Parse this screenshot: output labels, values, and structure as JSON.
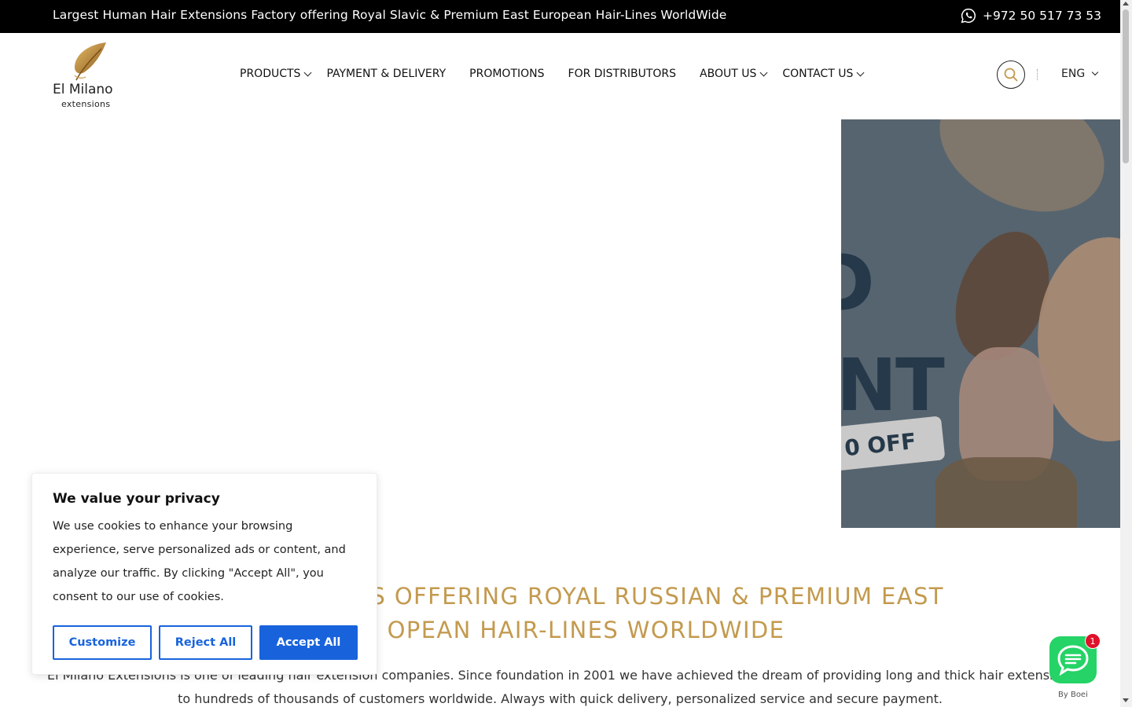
{
  "topbar": {
    "tagline": "Largest Human Hair Extensions Factory offering Royal Slavic & Premium East European Hair-Lines WorldWide",
    "phone": "+972 50 517 73 53",
    "phone_icon": "whatsapp-icon"
  },
  "logo": {
    "brand": "El Milano",
    "sub": "extensions"
  },
  "nav": {
    "items": [
      {
        "label": "PRODUCTS",
        "has_submenu": true
      },
      {
        "label": "PAYMENT & DELIVERY",
        "has_submenu": false
      },
      {
        "label": "PROMOTIONS",
        "has_submenu": false
      },
      {
        "label": "FOR DISTRIBUTORS",
        "has_submenu": false
      },
      {
        "label": "ABOUT US",
        "has_submenu": true
      },
      {
        "label": "CONTACT US",
        "has_submenu": true
      }
    ],
    "search_icon": "search-icon",
    "language": "ENG"
  },
  "hero": {
    "banner_text_partial_1": "D",
    "banner_text_partial_2": "NT",
    "banner_tag_partial": "0 OFF"
  },
  "main": {
    "heading_line1": "ONS OFFERING ROYAL RUSSIAN & PREMIUM EAST",
    "heading_line2": "OPEAN HAIR-LINES WORLDWIDE",
    "intro_line1": "El Milano Extensions is one of leading hair extension companies. Since foundation in 2001 we have achieved the dream of providing long and thick hair extensions",
    "intro_line2": "to hundreds of thousands of customers worldwide. Always with quick delivery, personalized service and secure payment."
  },
  "cookie": {
    "title": "We value your privacy",
    "body": "We use cookies to enhance your browsing experience, serve personalized ads or content, and analyze our traffic. By clicking \"Accept All\", you consent to our use of cookies.",
    "customize_label": "Customize",
    "reject_label": "Reject All",
    "accept_label": "Accept All",
    "accent_color": "#1863dc"
  },
  "chat": {
    "badge_count": "1",
    "by_label": "By Boei",
    "icon": "chat-bubble-icon"
  },
  "colors": {
    "gold": "#c39a4e",
    "topbar_bg": "#000000",
    "chat_green": "#25d366"
  }
}
